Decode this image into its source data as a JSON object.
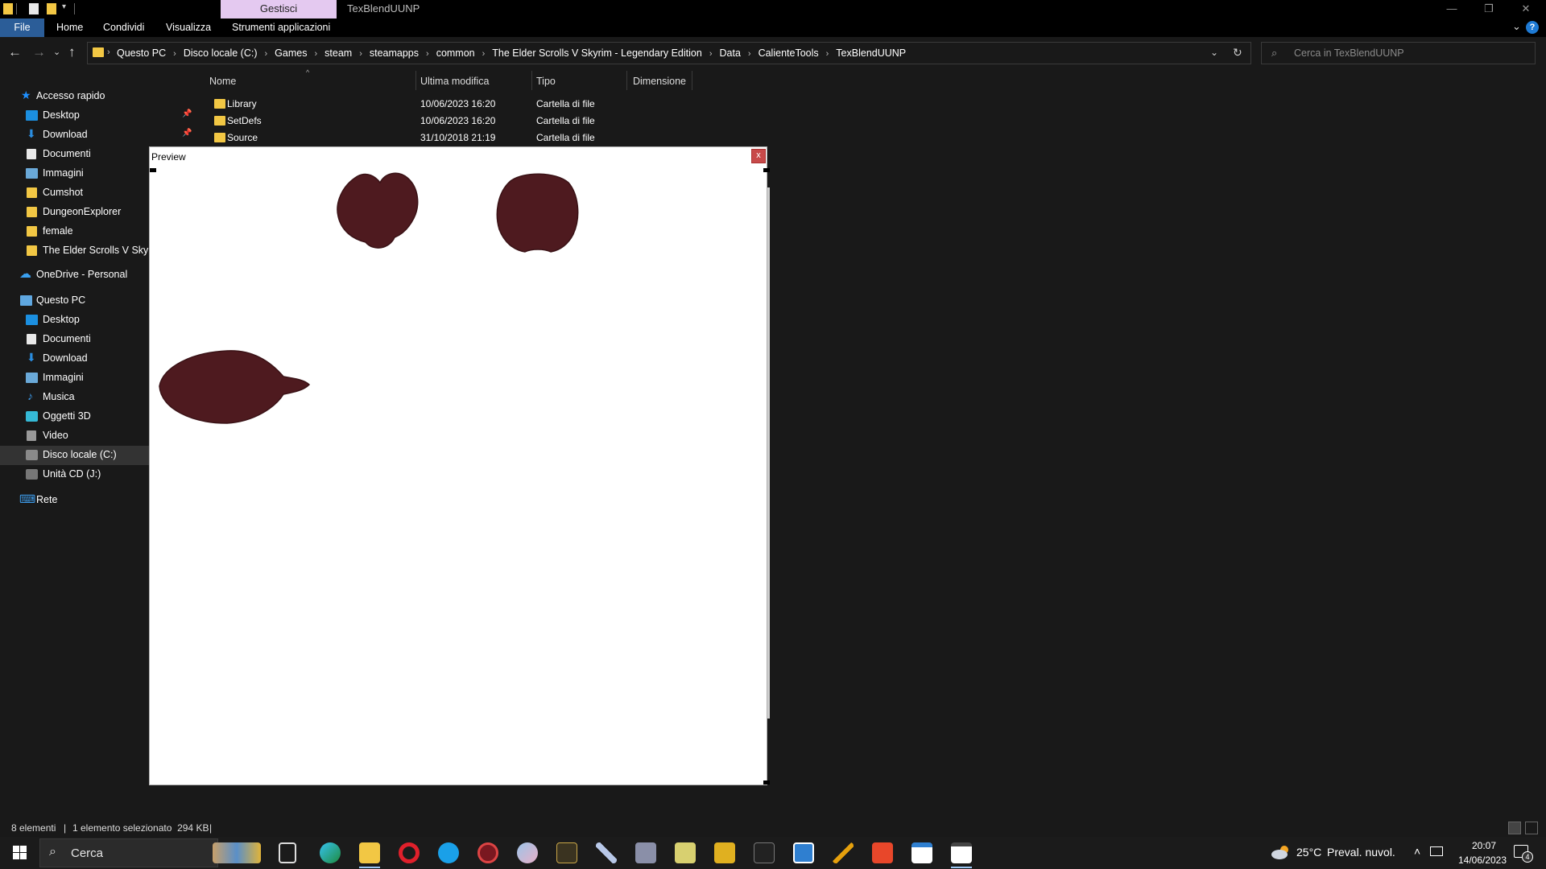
{
  "window": {
    "title": "TexBlendUUNP",
    "contextual_tab": "Gestisci",
    "controls": {
      "minimize": "—",
      "restore": "❐",
      "close": "✕"
    }
  },
  "ribbon": {
    "tabs": [
      "File",
      "Home",
      "Condividi",
      "Visualizza",
      "Strumenti applicazioni"
    ],
    "help": "?"
  },
  "address": {
    "breadcrumbs": [
      "Questo PC",
      "Disco locale (C:)",
      "Games",
      "steam",
      "steamapps",
      "common",
      "The Elder Scrolls V Skyrim - Legendary Edition",
      "Data",
      "CalienteTools",
      "TexBlendUUNP"
    ],
    "search_placeholder": "Cerca in TexBlendUUNP"
  },
  "nav": {
    "items": [
      {
        "label": "Accesso rapido",
        "icon": "star-icon"
      },
      {
        "label": "Desktop",
        "icon": "desktop-icon",
        "pinned": true
      },
      {
        "label": "Download",
        "icon": "download-icon",
        "pinned": true
      },
      {
        "label": "Documenti",
        "icon": "documents-icon"
      },
      {
        "label": "Immagini",
        "icon": "pictures-icon"
      },
      {
        "label": "Cumshot",
        "icon": "folder-icon"
      },
      {
        "label": "DungeonExplorer",
        "icon": "folder-icon"
      },
      {
        "label": "female",
        "icon": "folder-icon"
      },
      {
        "label": "The Elder Scrolls V Skyrim",
        "icon": "folder-icon"
      },
      {
        "label": "OneDrive - Personal",
        "icon": "onedrive-icon"
      },
      {
        "label": "Questo PC",
        "icon": "computer-icon"
      },
      {
        "label": "Desktop",
        "icon": "desktop-icon"
      },
      {
        "label": "Documenti",
        "icon": "documents-icon"
      },
      {
        "label": "Download",
        "icon": "download-icon"
      },
      {
        "label": "Immagini",
        "icon": "pictures-icon"
      },
      {
        "label": "Musica",
        "icon": "music-icon"
      },
      {
        "label": "Oggetti 3D",
        "icon": "3d-objects-icon"
      },
      {
        "label": "Video",
        "icon": "video-icon"
      },
      {
        "label": "Disco locale (C:)",
        "icon": "drive-icon",
        "selected": true
      },
      {
        "label": "Unità CD (J:)",
        "icon": "cd-drive-icon"
      },
      {
        "label": "Rete",
        "icon": "network-icon"
      }
    ]
  },
  "filelist": {
    "columns": [
      "Nome",
      "Ultima modifica",
      "Tipo",
      "Dimensione"
    ],
    "rows": [
      {
        "name": "Library",
        "modified": "10/06/2023 16:20",
        "type": "Cartella di file"
      },
      {
        "name": "SetDefs",
        "modified": "10/06/2023 16:20",
        "type": "Cartella di file"
      },
      {
        "name": "Source",
        "modified": "31/10/2018 21:19",
        "type": "Cartella di file"
      }
    ]
  },
  "preview": {
    "title": "Preview",
    "close": "x",
    "texture_color": "#4e1a1f"
  },
  "status": {
    "count": "8 elementi",
    "selection": "1 elemento selezionato  294 KB"
  },
  "taskbar": {
    "search_label": "Cerca",
    "temperature": "25°C",
    "condition": "Preval. nuvol.",
    "time": "20:07",
    "date": "14/06/2023",
    "notification_count": "4"
  },
  "colors": {
    "accent": "#2b5d98",
    "contextual_tab": "#e4c9f0",
    "folder": "#f2c744",
    "background": "#191919"
  }
}
